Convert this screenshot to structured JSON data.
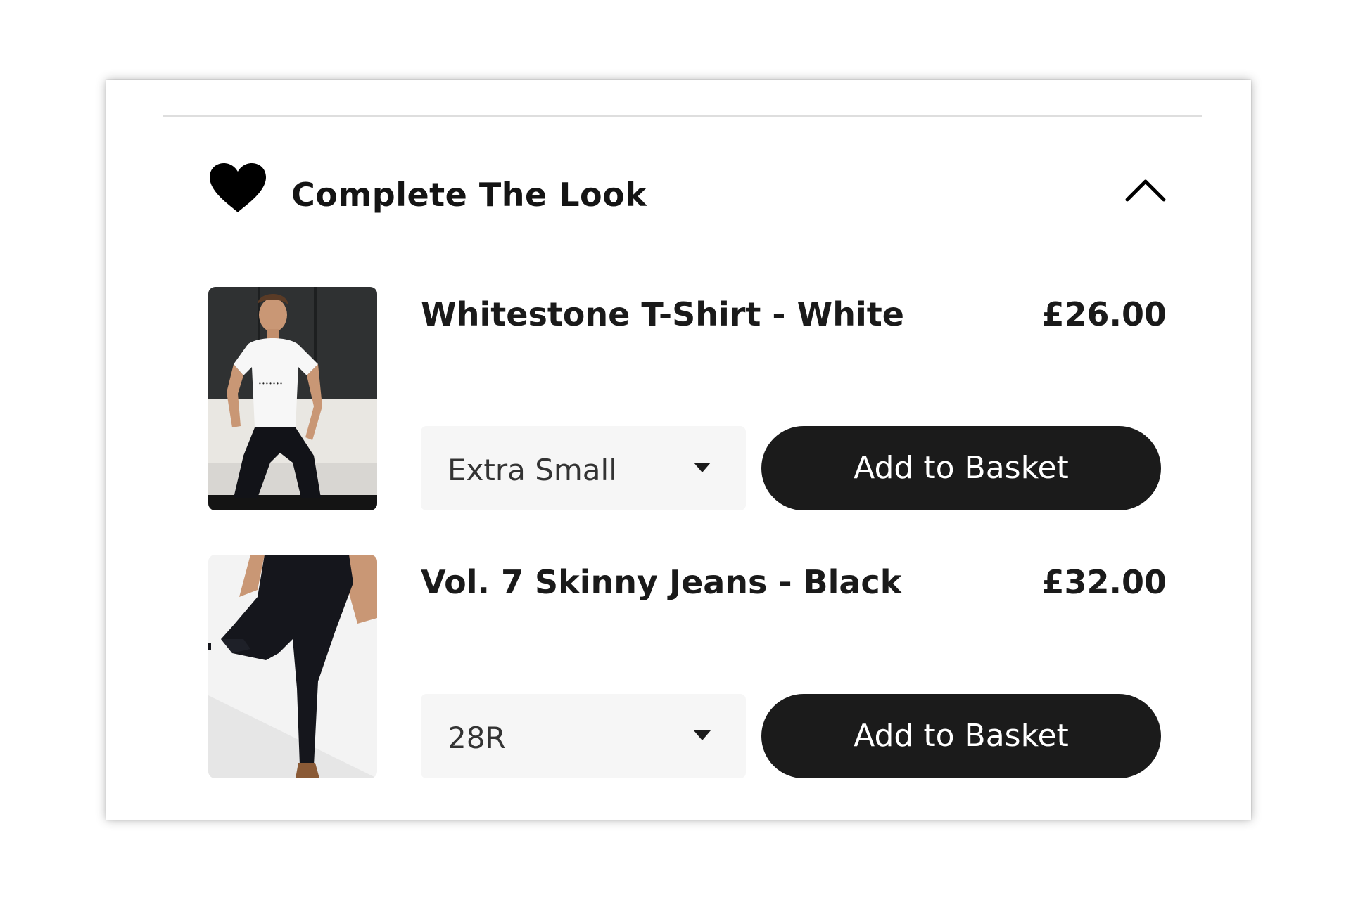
{
  "section": {
    "title": "Complete The Look",
    "heart_icon": "heart-icon",
    "collapse_icon": "chevron-up-icon"
  },
  "products": [
    {
      "name": "Whitestone T-Shirt - White",
      "price": "£26.00",
      "selected_size": "Extra Small",
      "button_label": "Add to Basket",
      "image_icon": "product-photo-tshirt"
    },
    {
      "name": "Vol. 7 Skinny Jeans - Black",
      "price": "£32.00",
      "selected_size": "28R",
      "button_label": "Add to Basket",
      "image_icon": "product-photo-jeans"
    }
  ],
  "colors": {
    "button_bg": "#1b1b1b",
    "button_text": "#ffffff",
    "select_bg": "#f6f6f6",
    "text": "#1a1a1a"
  }
}
